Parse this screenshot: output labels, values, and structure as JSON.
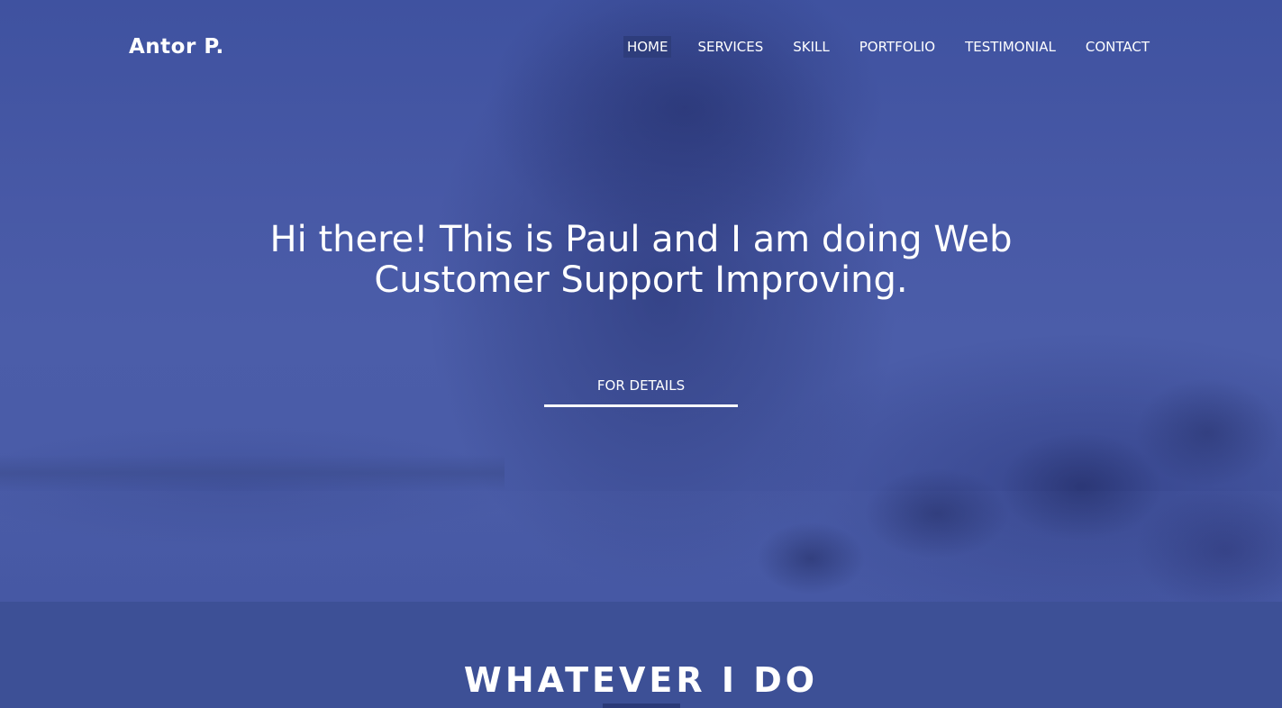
{
  "brand": {
    "logo_text": "Antor P."
  },
  "nav": {
    "items": [
      {
        "label": "HOME",
        "active": true
      },
      {
        "label": "SERVICES",
        "active": false
      },
      {
        "label": "SKILL",
        "active": false
      },
      {
        "label": "PORTFOLIO",
        "active": false
      },
      {
        "label": "TESTIMONIAL",
        "active": false
      },
      {
        "label": "CONTACT",
        "active": false
      }
    ]
  },
  "hero": {
    "headline_line1": "Hi there! This is Paul and I am doing Web",
    "headline_line2": "Customer Support Improving.",
    "cta_label": "FOR DETAILS"
  },
  "section": {
    "title": "WHATEVER I DO"
  },
  "colors": {
    "overlay_blue": "#4a5ca8",
    "section_bg": "#3d5096",
    "active_nav_bg": "#2e3d7c",
    "text": "#ffffff"
  }
}
